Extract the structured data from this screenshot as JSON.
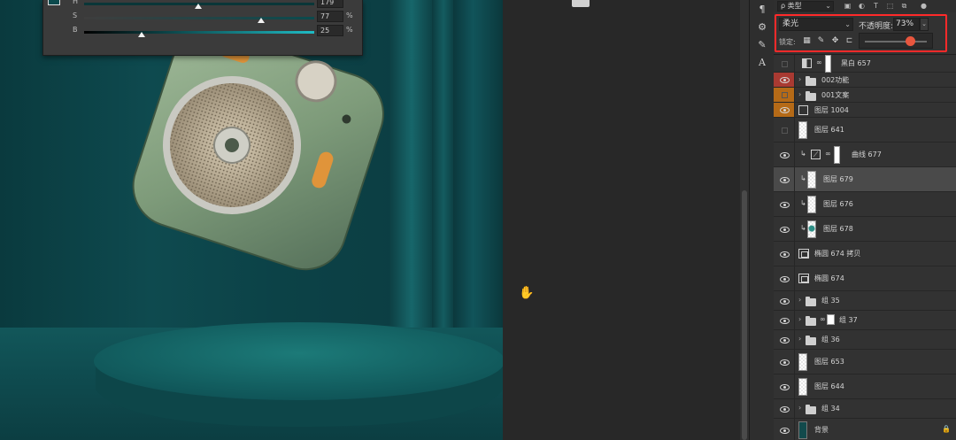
{
  "color_picker": {
    "rows": [
      {
        "letter": "H",
        "value": "179",
        "unit": ""
      },
      {
        "letter": "S",
        "value": "77",
        "unit": "%"
      },
      {
        "letter": "B",
        "value": "25",
        "unit": "%"
      }
    ],
    "colors": {
      "foreground": "#0b4a4d",
      "background": "#ffffff"
    }
  },
  "layers_panel": {
    "filter": {
      "kind_label": "ρ 类型"
    },
    "blend_mode": "柔光",
    "opacity_label": "不透明度:",
    "opacity_value": "73%",
    "opacity_fraction": 0.73,
    "lock_label": "锁定:",
    "layers": [
      {
        "name": "黑白 657",
        "type": "adjustment",
        "visible": false
      },
      {
        "name": "002功能",
        "type": "group",
        "visible": true,
        "color_tag": "red"
      },
      {
        "name": "001文案",
        "type": "group",
        "visible": false,
        "color_tag": "orange"
      },
      {
        "name": "图层 1004",
        "type": "smart",
        "visible": true,
        "color_tag": "orange"
      },
      {
        "name": "图层 641",
        "type": "pixel",
        "visible": false
      },
      {
        "name": "曲线 677",
        "type": "curves",
        "visible": true,
        "clipped": true
      },
      {
        "name": "图层 679",
        "type": "pixel",
        "visible": true,
        "clipped": true,
        "selected": true
      },
      {
        "name": "图层 676",
        "type": "pixel",
        "visible": true,
        "clipped": true
      },
      {
        "name": "图层 678",
        "type": "pixel",
        "visible": true,
        "clipped": true
      },
      {
        "name": "椭圆 674 拷贝",
        "type": "shape",
        "visible": true
      },
      {
        "name": "椭圆 674",
        "type": "shape",
        "visible": true
      },
      {
        "name": "组 35",
        "type": "group",
        "visible": true
      },
      {
        "name": "组 37",
        "type": "group",
        "visible": true,
        "has_mask": true
      },
      {
        "name": "组 36",
        "type": "group",
        "visible": true
      },
      {
        "name": "图层 653",
        "type": "pixel",
        "visible": true
      },
      {
        "name": "图层 644",
        "type": "pixel",
        "visible": true
      },
      {
        "name": "组 34",
        "type": "group",
        "visible": true
      },
      {
        "name": "背景",
        "type": "background",
        "visible": true,
        "locked": true
      }
    ]
  },
  "icons": {
    "tool_strip": [
      "paragraph-icon",
      "adjust-icon",
      "brush-presets-icon",
      "character-icon"
    ],
    "filter_bar": [
      "image-filter-icon",
      "adjustment-filter-icon",
      "type-filter-icon",
      "shape-filter-icon",
      "smart-filter-icon",
      "toggle-filter-icon"
    ],
    "locks": [
      "lock-pixels-icon",
      "lock-paint-icon",
      "lock-position-icon",
      "lock-artboard-icon"
    ],
    "canvas": [
      "hand-cursor-icon"
    ]
  },
  "accent": {
    "highlight": "#ff2a2a",
    "opacity_thumb": "#e8563e"
  }
}
